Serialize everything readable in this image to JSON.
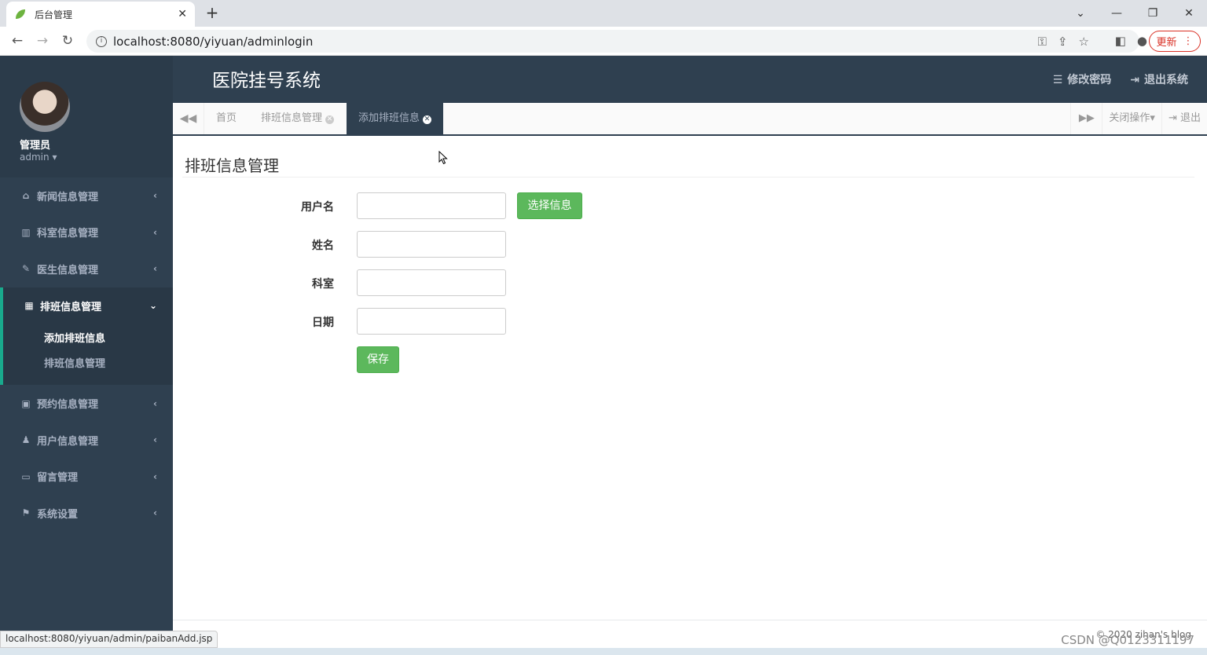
{
  "browser": {
    "tab_title": "后台管理",
    "url": "localhost:8080/yiyuan/adminlogin",
    "update_label": "更新",
    "status_url": "localhost:8080/yiyuan/admin/paibanAdd.jsp"
  },
  "sidebar": {
    "user_name": "管理员",
    "user_role": "admin",
    "items": [
      {
        "label": "新闻信息管理",
        "icon": "home-icon"
      },
      {
        "label": "科室信息管理",
        "icon": "bar-chart-icon"
      },
      {
        "label": "医生信息管理",
        "icon": "edit-icon"
      },
      {
        "label": "排班信息管理",
        "icon": "table-icon"
      },
      {
        "label": "预约信息管理",
        "icon": "picture-icon"
      },
      {
        "label": "用户信息管理",
        "icon": "person-icon"
      },
      {
        "label": "留言管理",
        "icon": "monitor-icon"
      },
      {
        "label": "系统设置",
        "icon": "flag-icon"
      }
    ],
    "sub_items": [
      "添加排班信息",
      "排班信息管理"
    ]
  },
  "header": {
    "title": "医院挂号系统",
    "change_password": "修改密码",
    "logout": "退出系统"
  },
  "content_tabs": {
    "home": "首页",
    "tab1": "排班信息管理",
    "tab2": "添加排班信息",
    "close_ops": "关闭操作",
    "exit": "退出"
  },
  "form": {
    "page_title": "排班信息管理",
    "username_label": "用户名",
    "select_button": "选择信息",
    "name_label": "姓名",
    "dept_label": "科室",
    "date_label": "日期",
    "username_value": "",
    "name_value": "",
    "dept_value": "",
    "date_value": "",
    "save_button": "保存"
  },
  "footer": {
    "copyright": "© 2020 zihan's blog",
    "watermark": "CSDN @Q0123311197"
  }
}
